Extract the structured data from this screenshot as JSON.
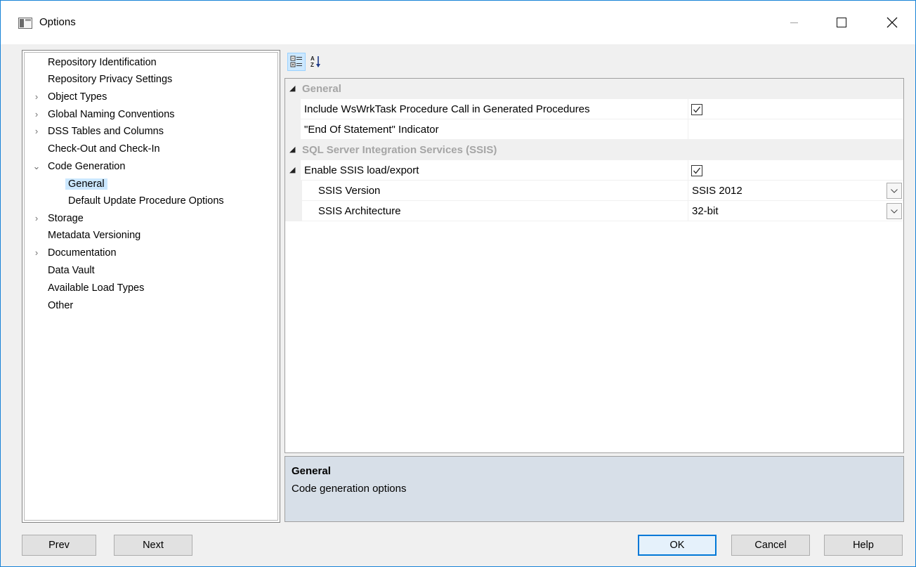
{
  "window": {
    "title": "Options",
    "min_icon": "minimize-icon",
    "max_icon": "maximize-icon",
    "close_icon": "close-icon"
  },
  "tree": {
    "items": [
      {
        "label": "Repository Identification",
        "expander": ""
      },
      {
        "label": "Repository Privacy Settings",
        "expander": ""
      },
      {
        "label": "Object Types",
        "expander": ">"
      },
      {
        "label": "Global Naming Conventions",
        "expander": ">"
      },
      {
        "label": "DSS Tables and Columns",
        "expander": ">"
      },
      {
        "label": "Check-Out and Check-In",
        "expander": ""
      },
      {
        "label": "Code Generation",
        "expander": "v"
      },
      {
        "label": "General",
        "expander": "",
        "selected": true
      },
      {
        "label": "Default Update Procedure Options",
        "expander": ""
      },
      {
        "label": "Storage",
        "expander": ">"
      },
      {
        "label": "Metadata Versioning",
        "expander": ""
      },
      {
        "label": "Documentation",
        "expander": ">"
      },
      {
        "label": "Data Vault",
        "expander": ""
      },
      {
        "label": "Available Load Types",
        "expander": ""
      },
      {
        "label": "Other",
        "expander": ""
      }
    ]
  },
  "toolbar": {
    "categorized_icon": "categorized-view-icon",
    "alphabetical_icon": "alphabetical-sort-icon"
  },
  "grid": {
    "cat_general": "General",
    "include_wswrktask_label": "Include WsWrkTask Procedure Call in Generated Procedures",
    "include_wswrktask_checked": true,
    "eos_indicator_label": "\"End Of Statement\" Indicator",
    "eos_indicator_value": "",
    "cat_ssis": "SQL Server Integration Services (SSIS)",
    "enable_ssis_label": "Enable SSIS load/export",
    "enable_ssis_checked": true,
    "ssis_version_label": "SSIS Version",
    "ssis_version_value": "SSIS 2012",
    "ssis_arch_label": "SSIS Architecture",
    "ssis_arch_value": "32-bit"
  },
  "description": {
    "title": "General",
    "text": "Code generation options"
  },
  "buttons": {
    "prev": "Prev",
    "next": "Next",
    "ok": "OK",
    "cancel": "Cancel",
    "help": "Help"
  },
  "colors": {
    "selection": "#cce8ff",
    "category_text": "#a5a5a5",
    "description_bg": "#d7dfe8",
    "default_button_border": "#0078d7"
  }
}
